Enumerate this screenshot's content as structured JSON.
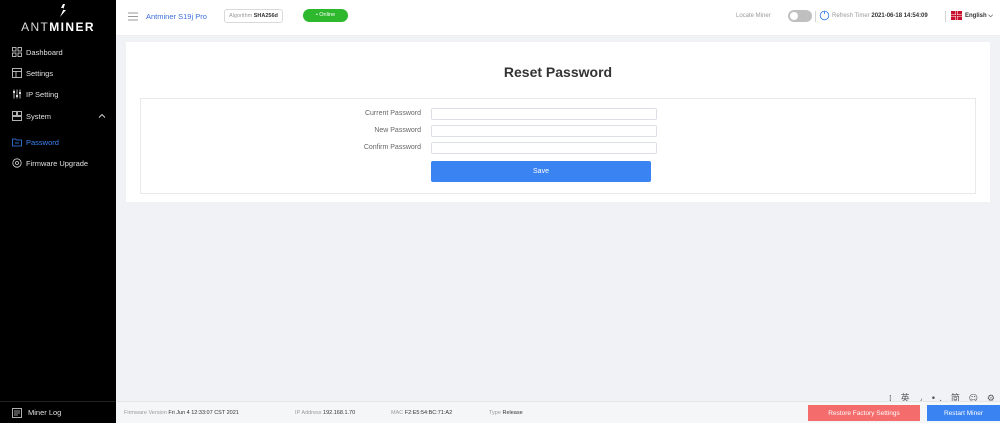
{
  "brand": {
    "prefix": "ANT",
    "suffix": "MINER"
  },
  "sidebar": {
    "items": [
      {
        "label": "Dashboard",
        "icon": "grid-icon"
      },
      {
        "label": "Settings",
        "icon": "settings-sheet-icon"
      },
      {
        "label": "IP Setting",
        "icon": "network-icon"
      },
      {
        "label": "System",
        "icon": "system-icon"
      }
    ],
    "sub_items": [
      {
        "label": "Password",
        "icon": "folder-key-icon"
      },
      {
        "label": "Firmware Upgrade",
        "icon": "circle-upgrade-icon"
      }
    ],
    "miner_log": "Miner Log"
  },
  "header": {
    "model": "Antminer S19j Pro",
    "algorithm_label": "Algorithm",
    "algorithm_value": "SHA256d",
    "status": "• Online",
    "locate_label": "Locate Miner",
    "refresh_label": "Refresh Timer",
    "refresh_value": "2021-06-18 14:54:09",
    "language": "English ⌵"
  },
  "main": {
    "title": "Reset Password",
    "fields": [
      {
        "label": "Current Password",
        "value": "",
        "placeholder": ""
      },
      {
        "label": "New Password",
        "value": "",
        "placeholder": ""
      },
      {
        "label": "Confirm Password",
        "value": "",
        "placeholder": ""
      }
    ],
    "save_label": "Save"
  },
  "ime_bar": "⁞ 英 ◞ •, 简 ☺ ⚙",
  "footer": {
    "firmware_label": "Firmware Version",
    "firmware_value": "Fri Jun 4 12:33:07 CST 2021",
    "ip_label": "IP Address",
    "ip_value": "192.168.1.70",
    "mac_label": "MAC",
    "mac_value": "F2:E5:54:BC:71:A2",
    "type_label": "Type",
    "type_value": "Release",
    "restore_label": "Restore Factory Settings",
    "restart_label": "Restart Miner"
  },
  "colors": {
    "accent": "#3a83f2",
    "online": "#2eb82e",
    "danger": "#f56c6c",
    "sidebar_bg": "#000000"
  }
}
